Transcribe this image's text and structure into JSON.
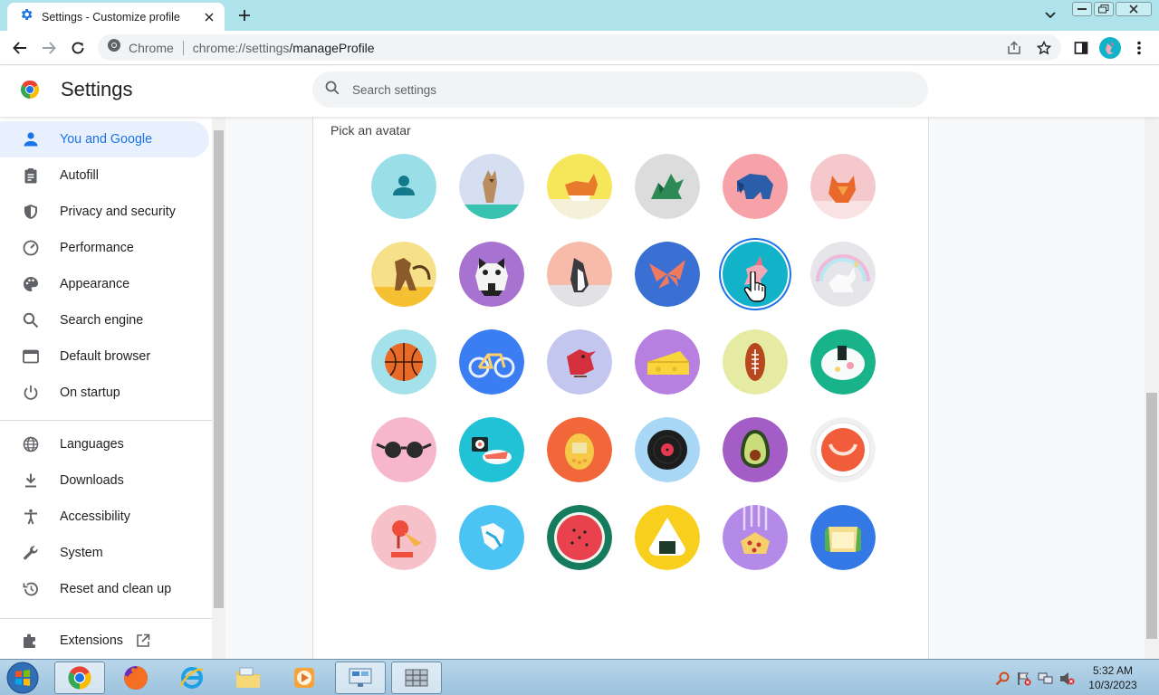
{
  "browser": {
    "tab_title": "Settings - Customize profile",
    "omnibox_site": "Chrome",
    "omnibox_url_host": "chrome://settings",
    "omnibox_url_path": "/manageProfile"
  },
  "header": {
    "title": "Settings",
    "search_placeholder": "Search settings"
  },
  "sidebar": {
    "items": [
      {
        "label": "You and Google",
        "icon": "person-icon",
        "active": true
      },
      {
        "label": "Autofill",
        "icon": "clipboard-icon"
      },
      {
        "label": "Privacy and security",
        "icon": "shield-icon"
      },
      {
        "label": "Performance",
        "icon": "speedometer-icon"
      },
      {
        "label": "Appearance",
        "icon": "palette-icon"
      },
      {
        "label": "Search engine",
        "icon": "search-icon"
      },
      {
        "label": "Default browser",
        "icon": "browser-window-icon"
      },
      {
        "label": "On startup",
        "icon": "power-icon"
      },
      {
        "label": "Languages",
        "icon": "globe-icon"
      },
      {
        "label": "Downloads",
        "icon": "download-icon"
      },
      {
        "label": "Accessibility",
        "icon": "accessibility-icon"
      },
      {
        "label": "System",
        "icon": "wrench-icon"
      },
      {
        "label": "Reset and clean up",
        "icon": "history-icon"
      },
      {
        "label": "Extensions",
        "icon": "puzzle-icon"
      }
    ]
  },
  "main": {
    "section_label": "Pick an avatar",
    "selected_avatar": "origami-rabbit",
    "avatars": [
      "generic-person",
      "origami-cat",
      "origami-corgi",
      "origami-dragon",
      "origami-elephant",
      "origami-fox",
      "origami-monkey",
      "origami-panda",
      "origami-penguin",
      "origami-butterfly",
      "origami-rabbit",
      "origami-unicorn",
      "basketball",
      "bicycle",
      "bird",
      "cheese",
      "football",
      "sushi-plate",
      "sunglasses",
      "sushi",
      "tamagotchi",
      "vinyl-record",
      "avocado",
      "cappuccino",
      "ice-cream",
      "flip-flop",
      "watermelon",
      "onigiri",
      "pizza",
      "sandwich"
    ]
  },
  "taskbar": {
    "time": "5:32 AM",
    "date": "10/3/2023"
  },
  "colors": {
    "accent": "#1a73e8",
    "tabstrip": "#aee3ec",
    "active_nav_bg": "#e8f0fe"
  }
}
